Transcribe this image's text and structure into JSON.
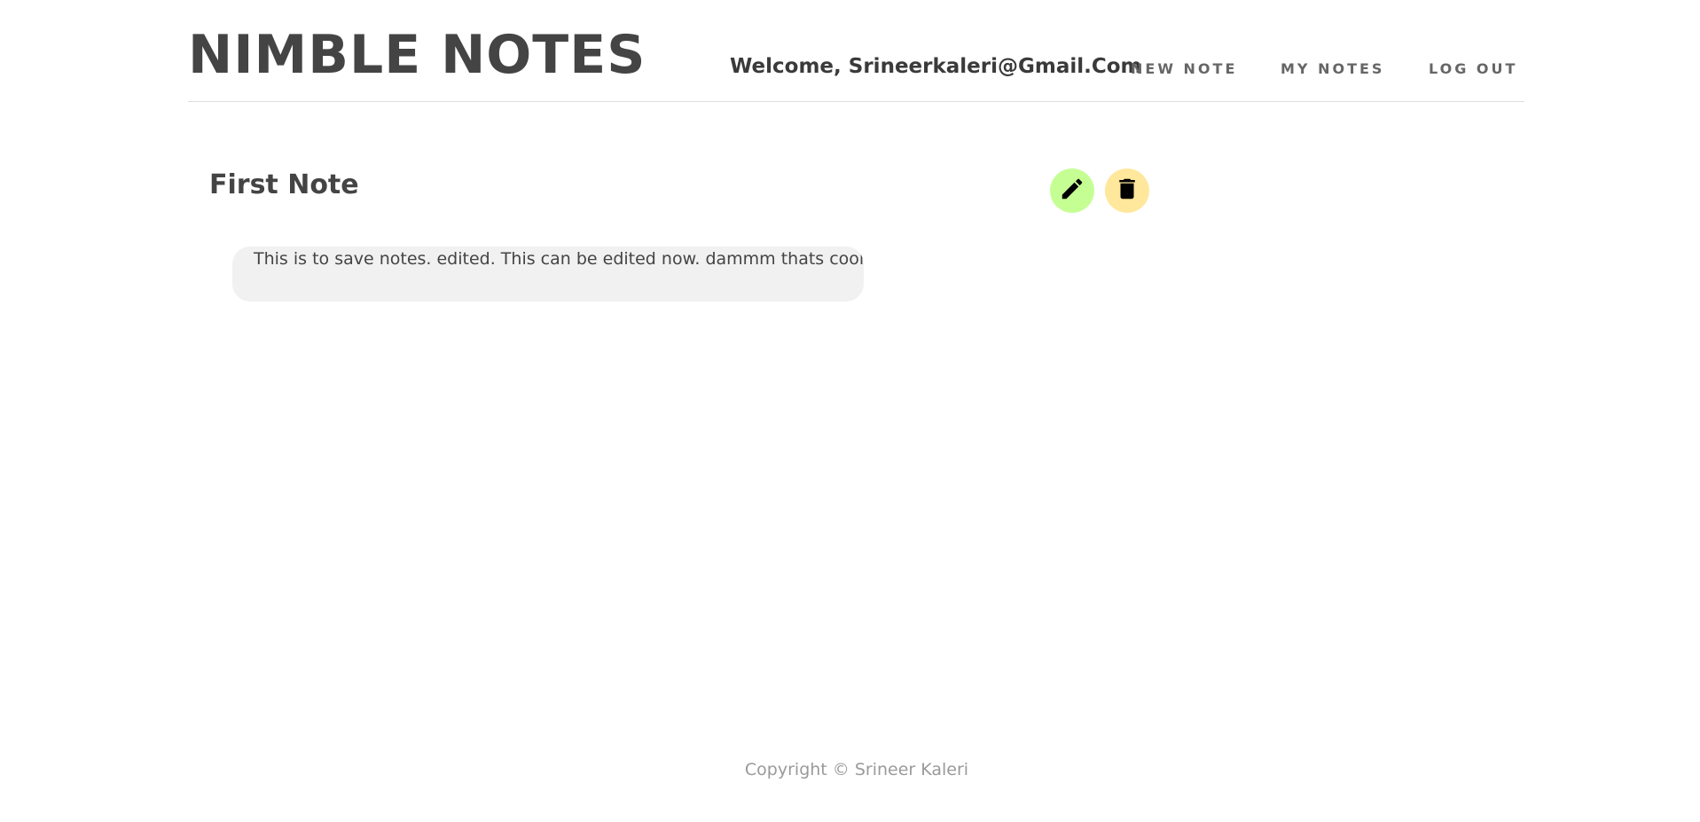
{
  "header": {
    "brand": "NIMBLE NOTES",
    "welcome": "Welcome, Srineerkaleri@Gmail.Com",
    "nav": {
      "new_note": "NEW NOTE",
      "my_notes": "MY NOTES",
      "log_out": "LOG OUT"
    }
  },
  "note": {
    "title": "First Note",
    "body": "This is to save notes. edited. This can be edited now. dammm thats cool",
    "edit_icon": "pencil-icon",
    "delete_icon": "trash-icon"
  },
  "footer": {
    "copyright": "Copyright © Srineer Kaleri"
  },
  "colors": {
    "edit_button": "#c5ff94",
    "delete_button": "#ffe79c",
    "note_background": "#f1f1f1",
    "text": "#444444"
  }
}
